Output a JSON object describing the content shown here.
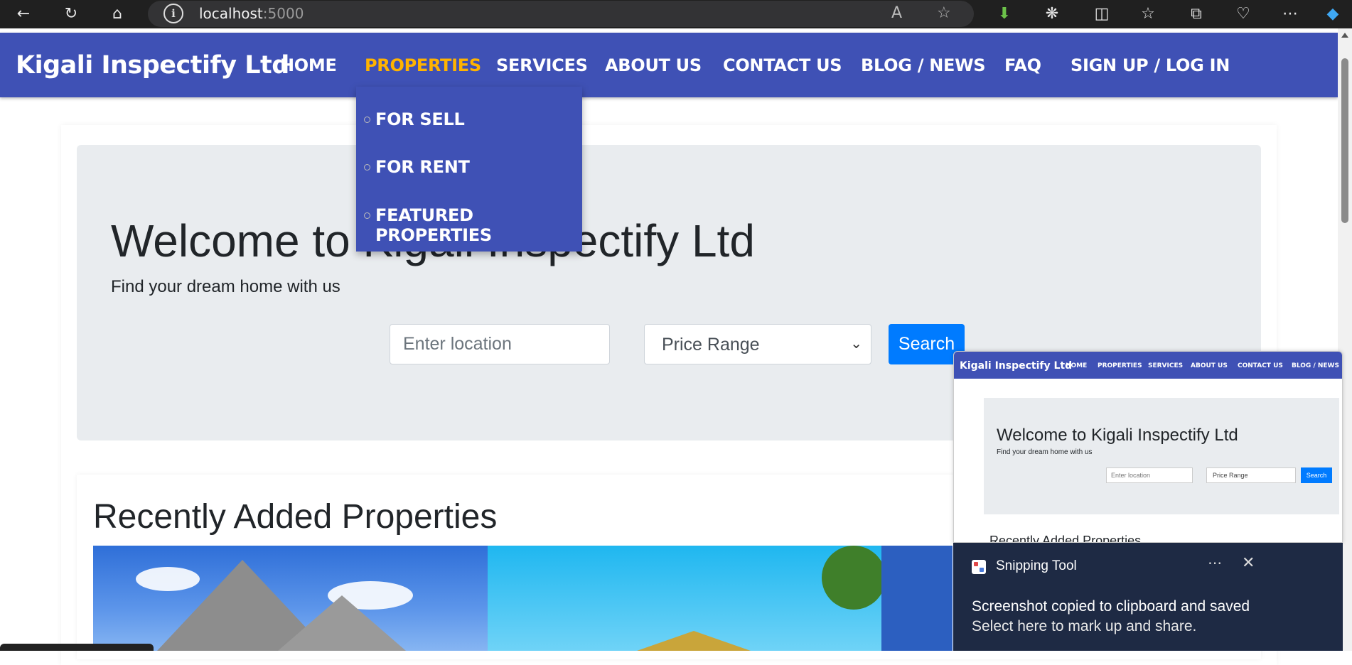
{
  "browser": {
    "url_host": "localhost",
    "url_port": ":5000"
  },
  "nav": {
    "brand": "Kigali Inspectify Ltd",
    "items": [
      {
        "label": "HOME"
      },
      {
        "label": "PROPERTIES"
      },
      {
        "label": "SERVICES"
      },
      {
        "label": "ABOUT US"
      },
      {
        "label": "CONTACT US"
      },
      {
        "label": "BLOG / NEWS"
      },
      {
        "label": "FAQ"
      },
      {
        "label": "SIGN UP / LOG IN"
      }
    ],
    "active_color": "#ffb300",
    "bg_color": "#3f51b5"
  },
  "dropdown": {
    "items": [
      {
        "label": "FOR SELL"
      },
      {
        "label": "FOR RENT"
      },
      {
        "label": "FEATURED PROPERTIES"
      }
    ]
  },
  "hero": {
    "title": "Welcome to Kigali Inspectify Ltd",
    "subtitle": "Find your dream home with us",
    "location_placeholder": "Enter location",
    "price_select": "Price Range",
    "search_label": "Search"
  },
  "recent": {
    "title": "Recently Added Properties"
  },
  "preview": {
    "brand": "Kigali Inspectify Ltd",
    "links": [
      "HOME",
      "PROPERTIES",
      "SERVICES",
      "ABOUT US",
      "CONTACT US",
      "BLOG / NEWS"
    ],
    "title": "Welcome to Kigali Inspectify Ltd",
    "subtitle": "Find your dream home with us",
    "location_placeholder": "Enter location",
    "price_select": "Price Range",
    "search_label": "Search",
    "recent_title": "Recently Added Properties"
  },
  "toast": {
    "app": "Snipping Tool",
    "line1": "Screenshot copied to clipboard and saved",
    "line2": "Select here to mark up and share."
  }
}
